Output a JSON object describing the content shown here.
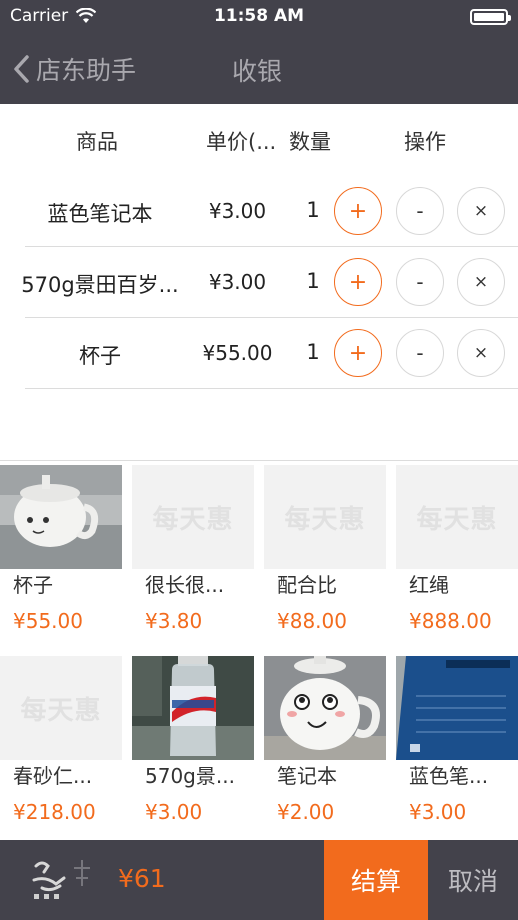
{
  "status_bar": {
    "carrier": "Carrier",
    "time": "11:58 AM"
  },
  "nav": {
    "back_label": "店东助手",
    "title": "收银"
  },
  "cart": {
    "headers": {
      "product": "商品",
      "unit_price": "单价(...",
      "quantity": "数量",
      "actions": "操作"
    },
    "items": [
      {
        "name": "蓝色笔记本",
        "price": "¥3.00",
        "qty": "1"
      },
      {
        "name": "570g景田百岁...",
        "price": "¥3.00",
        "qty": "1"
      },
      {
        "name": "杯子",
        "price": "¥55.00",
        "qty": "1"
      }
    ],
    "plus_label": "+",
    "minus_label": "-",
    "remove_label": "×"
  },
  "products": [
    {
      "name": "杯子",
      "price": "¥55.00",
      "image": "photo-cup"
    },
    {
      "name": "很长很...",
      "price": "¥3.80",
      "image": "placeholder"
    },
    {
      "name": "配合比",
      "price": "¥88.00",
      "image": "placeholder"
    },
    {
      "name": "红绳",
      "price": "¥888.00",
      "image": "placeholder"
    },
    {
      "name": "春砂仁...",
      "price": "¥218.00",
      "image": "placeholder"
    },
    {
      "name": "570g景...",
      "price": "¥3.00",
      "image": "photo-water-bottle"
    },
    {
      "name": "笔记本",
      "price": "¥2.00",
      "image": "photo-mug"
    },
    {
      "name": "蓝色笔...",
      "price": "¥3.00",
      "image": "photo-notebook"
    }
  ],
  "placeholder_text": "每天惠",
  "bottom_bar": {
    "total": "¥61",
    "checkout_label": "结算",
    "cancel_label": "取消"
  },
  "colors": {
    "accent": "#f26b1d",
    "bar": "#43424b"
  }
}
